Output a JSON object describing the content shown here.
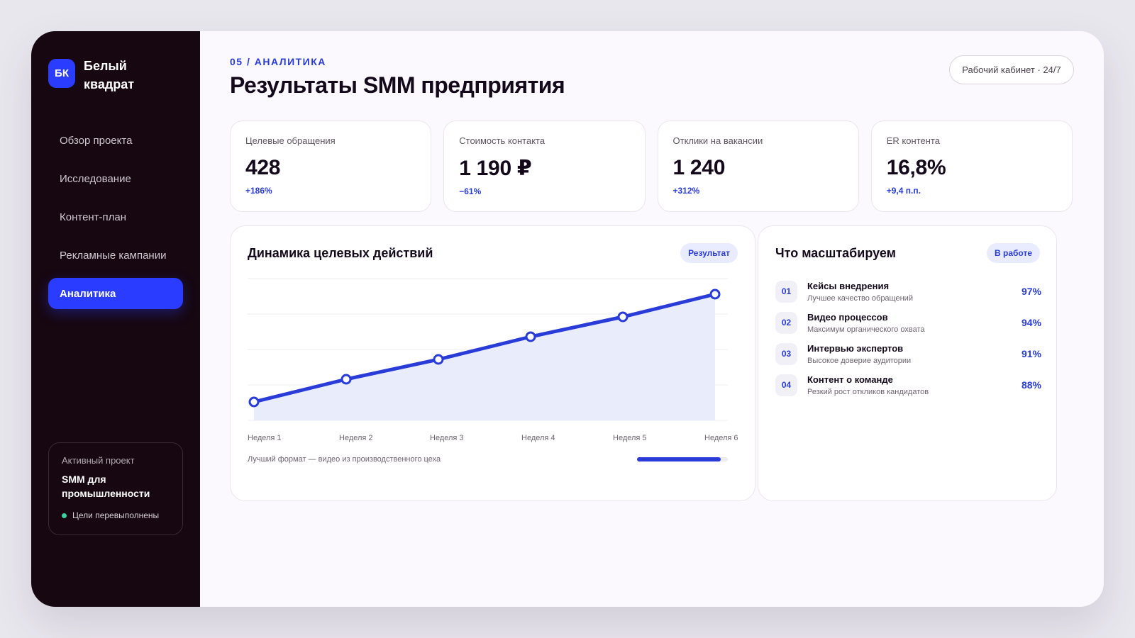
{
  "sidebar": {
    "logo": {
      "mark": "БК",
      "name": "Белый квадрат"
    },
    "nav": [
      {
        "label": "Обзор проекта",
        "active": false
      },
      {
        "label": "Исследование",
        "active": false
      },
      {
        "label": "Контент-план",
        "active": false
      },
      {
        "label": "Рекламные кампании",
        "active": false
      },
      {
        "label": "Аналитика",
        "active": true
      }
    ],
    "project": {
      "caption": "Активный проект",
      "title": "SMM для промышленности",
      "status": "Цели перевыполнены"
    }
  },
  "header": {
    "eyebrow": "05 / АНАЛИТИКА",
    "title": "Результаты SMM предприятия",
    "badge": "Рабочий кабинет · 24/7"
  },
  "stats": [
    {
      "label": "Целевые обращения",
      "value": "428",
      "delta": "+186%"
    },
    {
      "label": "Стоимость контакта",
      "value": "1 190 ₽",
      "delta": "−61%"
    },
    {
      "label": "Отклики на вакансии",
      "value": "1 240",
      "delta": "+312%"
    },
    {
      "label": "ER контента",
      "value": "16,8%",
      "delta": "+9,4 п.п."
    }
  ],
  "chart_panel": {
    "title": "Динамика целевых действий",
    "badge": "Результат",
    "note": "Лучший формат — видео из производственного цеха",
    "progress": 0.92
  },
  "chart_data": {
    "type": "area",
    "x": [
      "Неделя 1",
      "Неделя 2",
      "Неделя 3",
      "Неделя 4",
      "Неделя 5",
      "Неделя 6"
    ],
    "series": [
      {
        "values": [
          0.13,
          0.29,
          0.43,
          0.59,
          0.73,
          0.89
        ]
      }
    ],
    "ylim": [
      0,
      1
    ],
    "grid": true,
    "colors": {
      "line": "#2a3cd8",
      "area": "#e9ecfb"
    }
  },
  "list_panel": {
    "title": "Что масштабируем",
    "badge": "В работе",
    "items": [
      {
        "num": "01",
        "title": "Кейсы внедрения",
        "sub": "Лучшее качество обращений",
        "pct": "97%"
      },
      {
        "num": "02",
        "title": "Видео процессов",
        "sub": "Максимум органического охвата",
        "pct": "94%"
      },
      {
        "num": "03",
        "title": "Интервью экспертов",
        "sub": "Высокое доверие аудитории",
        "pct": "91%"
      },
      {
        "num": "04",
        "title": "Контент о команде",
        "sub": "Резкий рост откликов кандидатов",
        "pct": "88%"
      }
    ]
  },
  "colors": {
    "accent": "#2a3cff",
    "sidebar_bg": "#170711",
    "text": "#14091a",
    "status_ok": "#3ad29f"
  }
}
